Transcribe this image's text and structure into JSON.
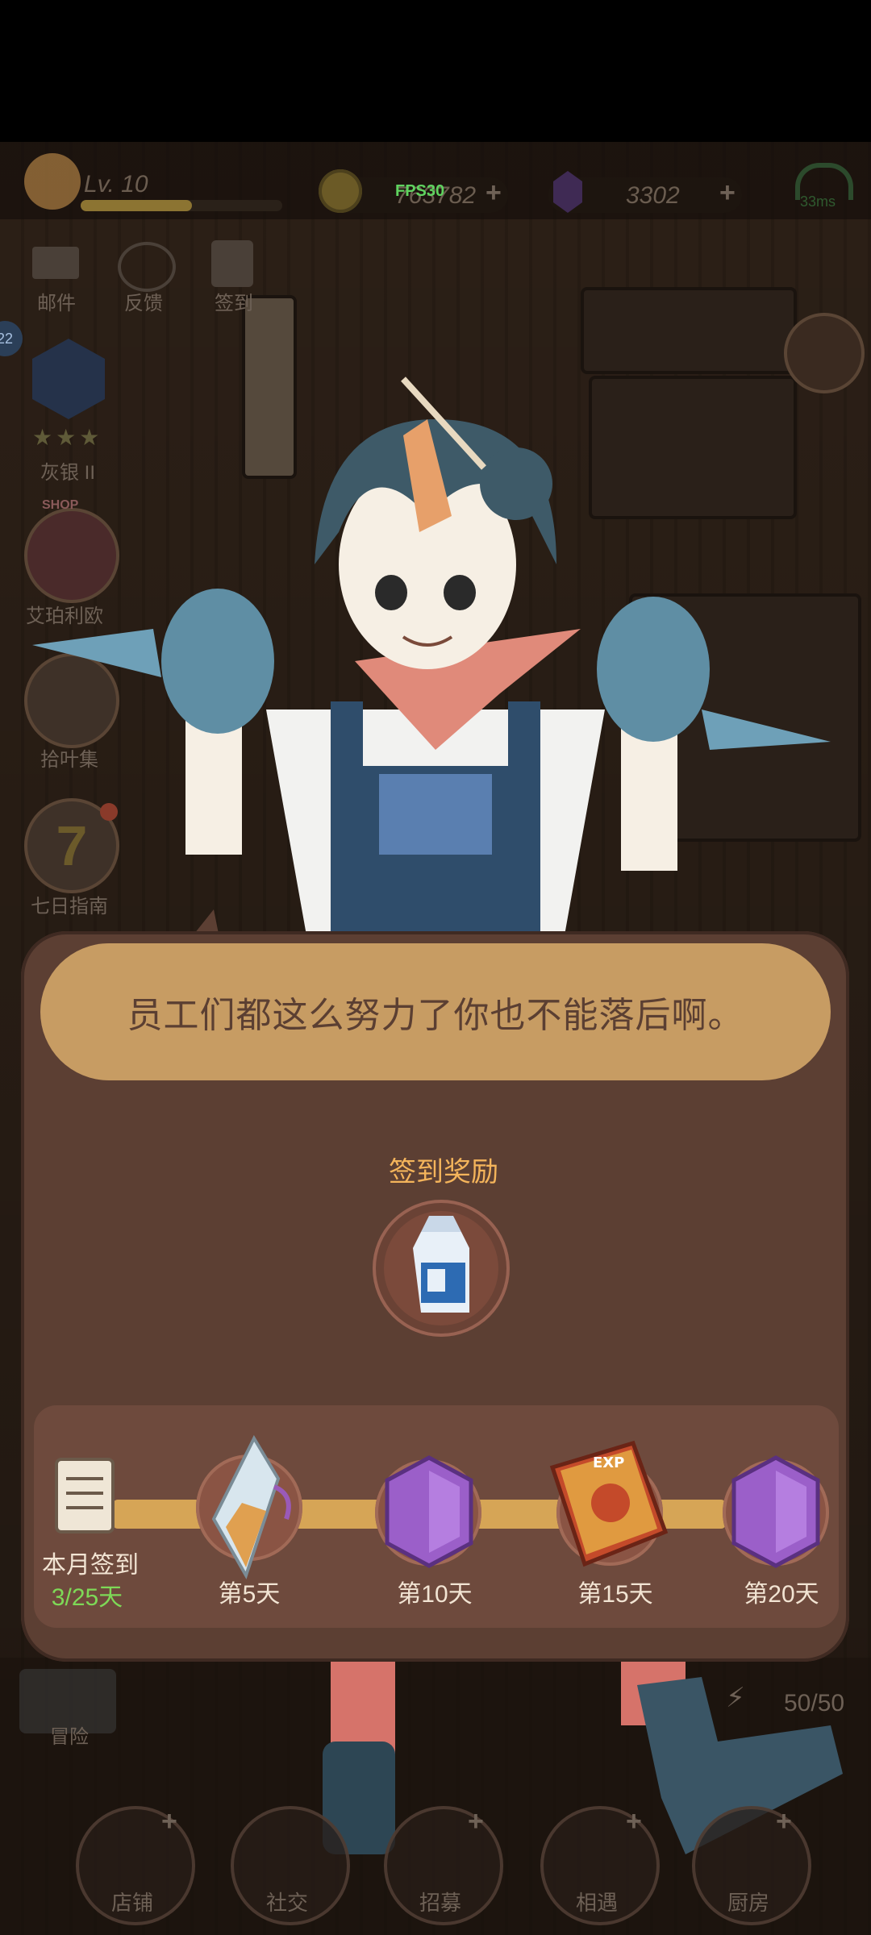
{
  "topbar": {
    "level": "Lv. 10",
    "gold": "763782",
    "fps": "FPS30",
    "gems": "3302",
    "ping": "33ms"
  },
  "side": {
    "mail": "邮件",
    "feedback": "反馈",
    "checkin": "签到",
    "rank": "灰银 II",
    "shop_badge": "SHOP",
    "shop": "艾珀利欧",
    "market": "拾叶集",
    "guide": "七日指南",
    "notif_count": "22",
    "adventure": "冒险",
    "energy": "50/50"
  },
  "dialog": {
    "speech": "员工们都这么努力了你也不能落后啊。",
    "reward_title": "签到奖励",
    "month_label": "本月签到",
    "progress": "3/25天",
    "milestones": [
      {
        "label": "第5天",
        "icon": "crystal-potion-icon"
      },
      {
        "label": "第10天",
        "icon": "purple-gem-icon"
      },
      {
        "label": "第15天",
        "icon": "exp-book-icon"
      },
      {
        "label": "第20天",
        "icon": "purple-gem-icon"
      }
    ]
  },
  "nav": {
    "items": [
      "店铺",
      "社交",
      "招募",
      "相遇",
      "厨房"
    ]
  },
  "colors": {
    "panel": "#5c3f33",
    "bubble": "#c79c63",
    "accent_orange": "#f4b45b",
    "progress_green": "#7ed957",
    "gem_purple": "#9b5fc9"
  }
}
